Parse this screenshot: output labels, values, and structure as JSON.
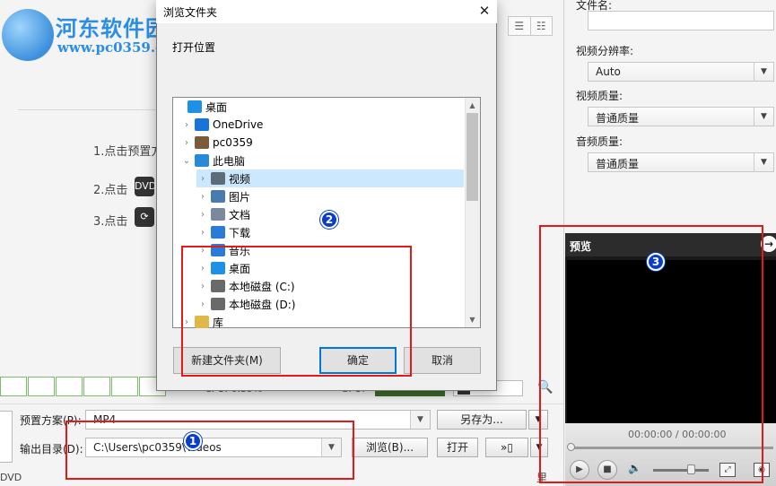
{
  "watermark": {
    "name": "河东软件园",
    "url": "www.pc0359.cn"
  },
  "main": {
    "steps": [
      {
        "label": "1.点击预置方"
      },
      {
        "label": "2.点击",
        "icon": "dvd-icon"
      },
      {
        "label": "3.点击",
        "icon": "convert-icon"
      }
    ],
    "view_buttons": [
      "☰",
      "☷"
    ],
    "gpu_text": "CPU: 0.39%",
    "gpu_label": "GPU:",
    "cuda_label": "CUDA",
    "app_label": "APP",
    "preset_label": "预置方案(P):",
    "preset_value": "MP4",
    "saveas_button": "另存为...",
    "output_label": "输出目录(D):",
    "output_value": "C:\\Users\\pc0359\\Videos",
    "browse_button": "浏览(B)...",
    "open_button": "打开",
    "dvd_text": "DVD",
    "corner_text": "里"
  },
  "right_panel": {
    "filename_label": "文件名:",
    "resolution_label": "视频分辨率:",
    "resolution_value": "Auto",
    "video_quality_label": "视频质量:",
    "video_quality_value": "普通质量",
    "audio_quality_label": "音频质量:",
    "audio_quality_value": "普通质量"
  },
  "preview": {
    "title": "预览",
    "time": "00:00:00 / 00:00:00"
  },
  "dialog": {
    "title": "浏览文件夹",
    "close": "✕",
    "subtitle": "打开位置",
    "tree": [
      {
        "label": "桌面",
        "icon_color": "#1e90e6",
        "chevron": ""
      },
      {
        "label": "OneDrive",
        "icon_color": "#1a73d9",
        "chevron": "›"
      },
      {
        "label": "pc0359",
        "icon_color": "#7a5b3a",
        "chevron": "›"
      },
      {
        "label": "此电脑",
        "icon_color": "#2a8ad8",
        "chevron": "⌄"
      },
      {
        "label": "视频",
        "icon_color": "#5b6d7a",
        "chevron": "›"
      },
      {
        "label": "图片",
        "icon_color": "#4a7bb0",
        "chevron": "›"
      },
      {
        "label": "文档",
        "icon_color": "#7a8a9a",
        "chevron": "›"
      },
      {
        "label": "下载",
        "icon_color": "#2a7ad8",
        "chevron": "›"
      },
      {
        "label": "音乐",
        "icon_color": "#2a7ad8",
        "chevron": "›"
      },
      {
        "label": "桌面",
        "icon_color": "#1e90e6",
        "chevron": "›"
      },
      {
        "label": "本地磁盘 (C:)",
        "icon_color": "#6a6a6a",
        "chevron": "›"
      },
      {
        "label": "本地磁盘 (D:)",
        "icon_color": "#6a6a6a",
        "chevron": "›"
      },
      {
        "label": "库",
        "icon_color": "#e0b84a",
        "chevron": "›"
      }
    ],
    "new_folder_button": "新建文件夹(M)",
    "ok_button": "确定",
    "cancel_button": "取消"
  },
  "annotations": [
    "1",
    "2",
    "3"
  ],
  "colors": {
    "accent": "#0078d7",
    "highlight": "#e21a1a",
    "badge": "#0a3ec8"
  }
}
